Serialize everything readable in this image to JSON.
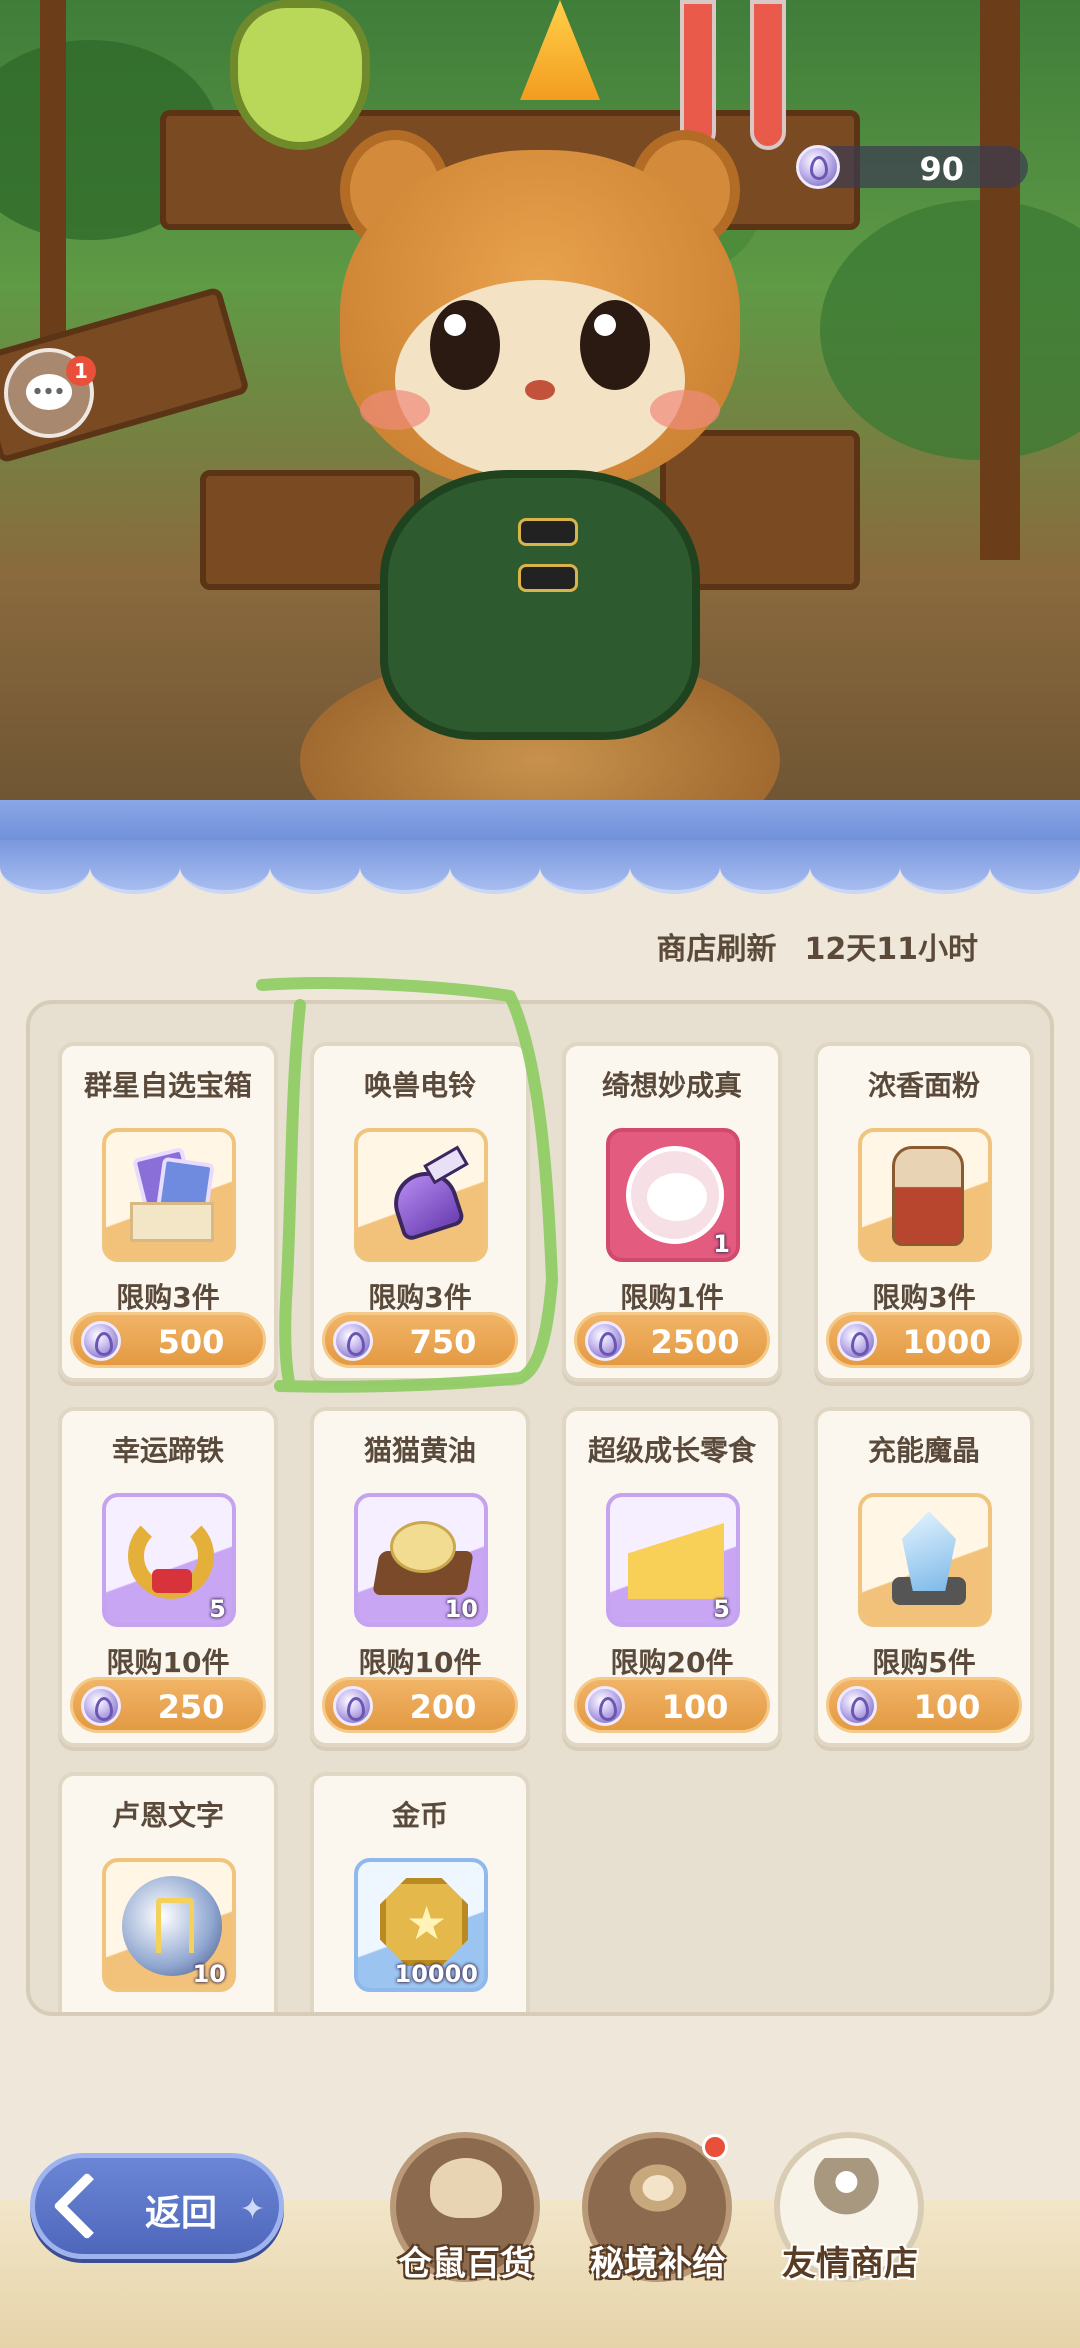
{
  "currency": {
    "amount": "90",
    "icon": "star-gem-icon"
  },
  "chat": {
    "badge": "1"
  },
  "shop": {
    "refresh_label": "商店刷新",
    "refresh_time": "12天11小时",
    "items": [
      {
        "name": "群星自选宝箱",
        "limit": "限购3件",
        "price": "500",
        "qty": ""
      },
      {
        "name": "唤兽电铃",
        "limit": "限购3件",
        "price": "750",
        "qty": ""
      },
      {
        "name": "绮想妙成真",
        "limit": "限购1件",
        "price": "2500",
        "qty": "1"
      },
      {
        "name": "浓香面粉",
        "limit": "限购3件",
        "price": "1000",
        "qty": ""
      },
      {
        "name": "幸运蹄铁",
        "limit": "限购10件",
        "price": "250",
        "qty": "5"
      },
      {
        "name": "猫猫黄油",
        "limit": "限购10件",
        "price": "200",
        "qty": "10"
      },
      {
        "name": "超级成长零食",
        "limit": "限购20件",
        "price": "100",
        "qty": "5"
      },
      {
        "name": "充能魔晶",
        "limit": "限购5件",
        "price": "100",
        "qty": ""
      },
      {
        "name": "卢恩文字",
        "limit": "",
        "price": "",
        "qty": "10"
      },
      {
        "name": "金币",
        "limit": "",
        "price": "",
        "qty": "10000"
      }
    ]
  },
  "nav": {
    "back_label": "返回",
    "tabs": [
      {
        "label": "仓鼠百货",
        "active": false,
        "badge": false
      },
      {
        "label": "秘境补给",
        "active": false,
        "badge": true
      },
      {
        "label": "友情商店",
        "active": true,
        "badge": false
      }
    ]
  },
  "colors": {
    "price_button": "#e39a43",
    "panel_bg": "#e7dfcf",
    "awning": "#7b98df",
    "back_button": "#5570c4",
    "annotation_stroke": "#7fc15a"
  }
}
